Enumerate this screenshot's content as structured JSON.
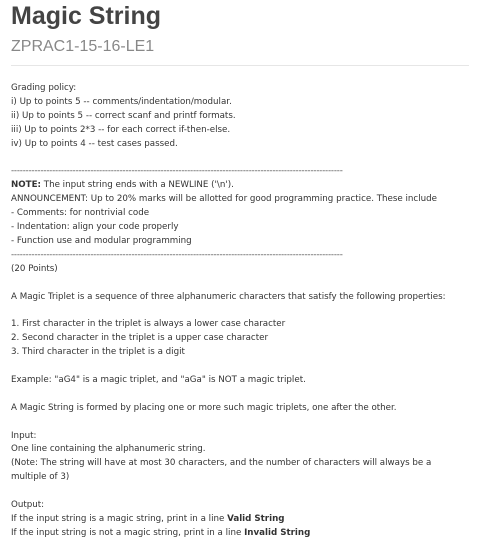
{
  "title": "Magic String",
  "code": "ZPRAC1-15-16-LE1",
  "grading": {
    "heading": "Grading policy:",
    "items": [
      "i) Up to points 5 -- comments/indentation/modular.",
      "ii) Up to points 5 -- correct scanf and printf formats.",
      "iii) Up to points 2*3 -- for each correct if-then-else.",
      "iv) Up to points 4 -- test cases passed."
    ]
  },
  "separator": "------------------------------------------------------------------------------------------------------------------------------------",
  "note": {
    "label": "NOTE:",
    "text": " The input string ends with a NEWLINE ('\\n')."
  },
  "announcement": {
    "text": "ANNOUNCEMENT: Up to 20% marks will be allotted for good programming practice. These include",
    "items": [
      "- Comments: for nontrivial code",
      "- Indentation: align your code properly",
      "- Function use and modular programming"
    ]
  },
  "points": "(20 Points)",
  "intro": "A Magic Triplet is a sequence of three alphanumeric characters that satisfy the following properties:",
  "properties": [
    "1. First character in the triplet is always a lower case character",
    "2. Second character in the triplet is a upper case character",
    "3. Third character in the triplet is a digit"
  ],
  "example": "Example: \"aG4\" is a magic triplet, and \"aGa\" is NOT a magic triplet.",
  "magic_string": "A Magic String is formed by placing one or more such magic triplets, one after the other.",
  "input": {
    "heading": "Input:",
    "line1": "One line containing the alphanumeric string.",
    "line2": "(Note: The string will have at most 30 characters, and the number of characters will always be a multiple of 3)"
  },
  "output": {
    "heading": "Output:",
    "valid_prefix": "If the input string is a magic string, print in a line ",
    "valid_value": "Valid String",
    "invalid_prefix": "If the input string is not a magic string, print in a line ",
    "invalid_value": "Invalid String"
  }
}
